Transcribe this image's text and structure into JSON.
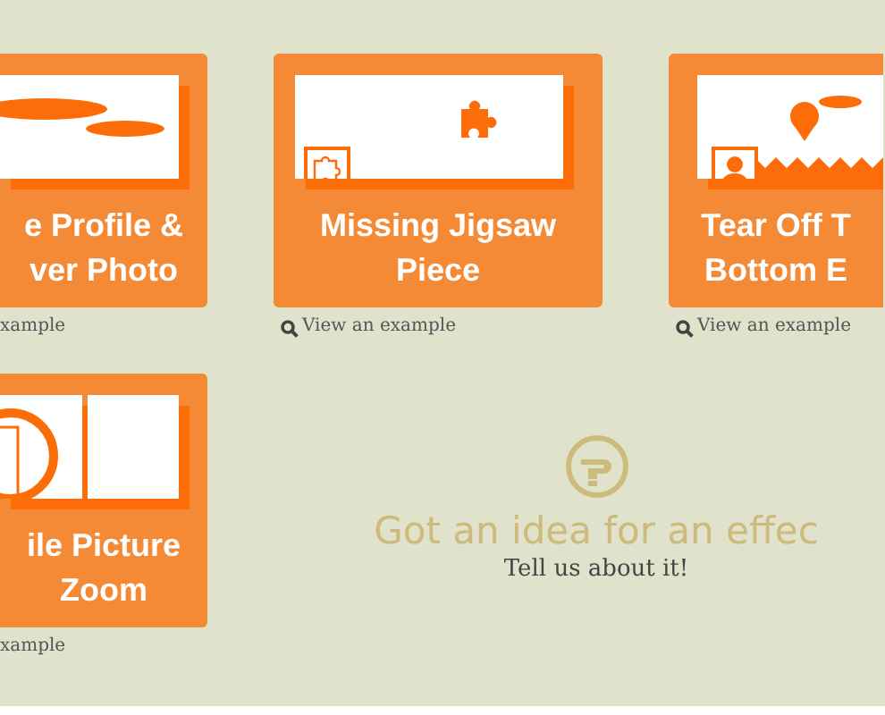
{
  "cards": [
    {
      "kind": "clouds",
      "title_lines": [
        "e Profile &",
        "ver Photo"
      ],
      "link": "xample",
      "link_icon": false
    },
    {
      "kind": "jigsaw",
      "title_lines": [
        "Missing Jigsaw",
        "Piece"
      ],
      "link": "View an example",
      "link_icon": true
    },
    {
      "kind": "balloon",
      "title_lines": [
        "Tear Off T",
        "Bottom E"
      ],
      "link": "View an example",
      "link_icon": true
    },
    {
      "kind": "zoom",
      "title_lines": [
        "ile Picture",
        "Zoom"
      ],
      "link": "xample",
      "link_icon": false
    }
  ],
  "idea": {
    "heading": "Got an idea for an effec",
    "link": "Tell us about it!"
  }
}
